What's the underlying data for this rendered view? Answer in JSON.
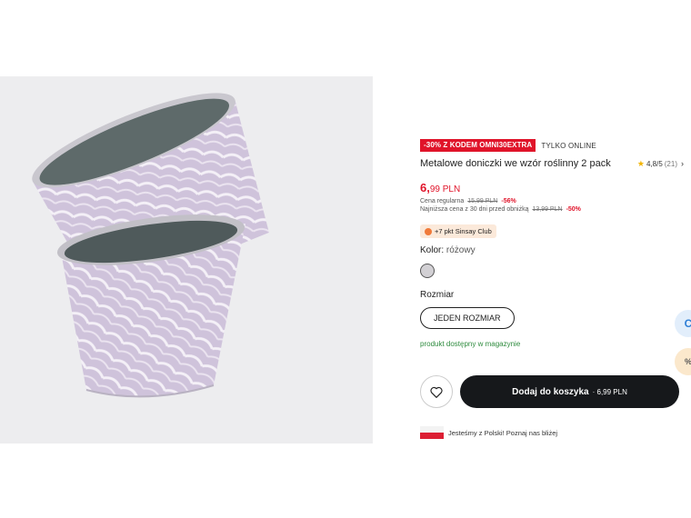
{
  "product": {
    "promo_badge": "-30% Z KODEM OMNI30EXTRA",
    "online_label": "TYLKO ONLINE",
    "title": "Metalowe doniczki we wzór roślinny 2 pack",
    "rating": {
      "score": "4,8/5",
      "count": "(21)"
    },
    "price": {
      "main": "6,",
      "decimals": "99 PLN"
    },
    "regular_price": {
      "label": "Cena regularna",
      "old": "15,99 PLN",
      "discount": "-56%"
    },
    "lowest_price": {
      "label": "Najniższa cena z 30 dni przed obniżką",
      "old": "13,99 PLN",
      "discount": "-50%"
    },
    "club": "+7 pkt Sinsay Club",
    "color": {
      "label": "Kolor:",
      "value": "różowy"
    },
    "size": {
      "label": "Rozmiar",
      "option": "JEDEN ROZMIAR"
    },
    "availability": "produkt dostępny w magazynie",
    "cart": {
      "label": "Dodaj do koszyka",
      "price": "· 6,99 PLN"
    },
    "poland_note": "Jesteśmy z Polski! Poznaj nas bliżej"
  },
  "floating": {
    "btn1_icon": "C",
    "btn2_icon": "%"
  },
  "icons": [
    "heart-icon",
    "star-icon",
    "chevron-right-icon",
    "club-coin-icon",
    "poland-flag-icon"
  ],
  "colors": {
    "accent": "#e0142a",
    "cart_button": "#16181b",
    "availability": "#2e8b3e",
    "club_bg": "#fbe9da"
  }
}
